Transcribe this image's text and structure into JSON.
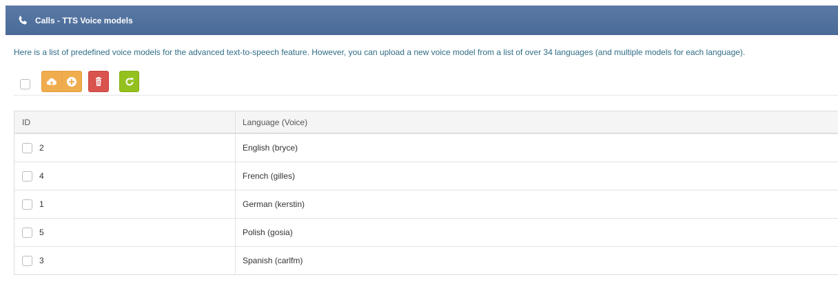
{
  "header": {
    "title": "Calls - TTS Voice models",
    "icon": "phone-icon",
    "background": "#4e6e9c"
  },
  "description": "Here is a list of predefined voice models for the advanced text-to-speech feature. However, you can upload a new voice model from a list of over 34 languages (and multiple models for each language).",
  "toolbar": {
    "buttons": [
      {
        "icon": "cloud-upload-icon",
        "color": "#f0ad4e"
      },
      {
        "icon": "add-icon",
        "color": "#f0ad4e"
      },
      {
        "icon": "trash-icon",
        "color": "#d9534f"
      },
      {
        "icon": "refresh-icon",
        "color": "#95c11f"
      }
    ]
  },
  "table": {
    "columns": [
      "ID",
      "Language (Voice)"
    ],
    "rows": [
      {
        "id": "2",
        "language": "English (bryce)"
      },
      {
        "id": "4",
        "language": "French (gilles)"
      },
      {
        "id": "1",
        "language": "German (kerstin)"
      },
      {
        "id": "5",
        "language": "Polish (gosia)"
      },
      {
        "id": "3",
        "language": "Spanish (carlfm)"
      }
    ]
  }
}
